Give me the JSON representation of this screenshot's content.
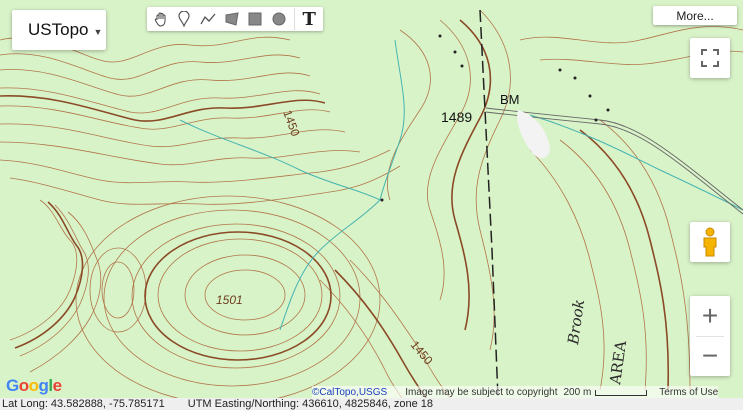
{
  "layer_selector": {
    "label": "USTopo"
  },
  "toolbar": {
    "tools": [
      "hand-icon",
      "marker-icon",
      "line-icon",
      "polygon-icon",
      "rectangle-icon",
      "circle-icon"
    ],
    "text_tool_label": "T"
  },
  "more_button": {
    "label": "More..."
  },
  "map_labels": {
    "elev_1450_a": "1450",
    "elev_1450_b": "1450",
    "elev_1489": "1489",
    "bm": "BM",
    "elev_1501": "1501",
    "brook": "Brook",
    "area": "AREA"
  },
  "attribution": {
    "source": "©CalTopo,USGS",
    "copyright": "Image may be subject to copyright",
    "scale": "200 m",
    "terms": "Terms of Use"
  },
  "google_logo": "Google",
  "status_bar": {
    "latlong": "Lat Long: 43.582888, -75.785171",
    "utm": "UTM Easting/Northing: 436610, 4825846, zone 18"
  },
  "colors": {
    "map_bg": "#d9f3c9",
    "contour": "#b07548",
    "index_contour": "#8a4a25",
    "stream": "#46b4b0",
    "road": "#222222"
  }
}
